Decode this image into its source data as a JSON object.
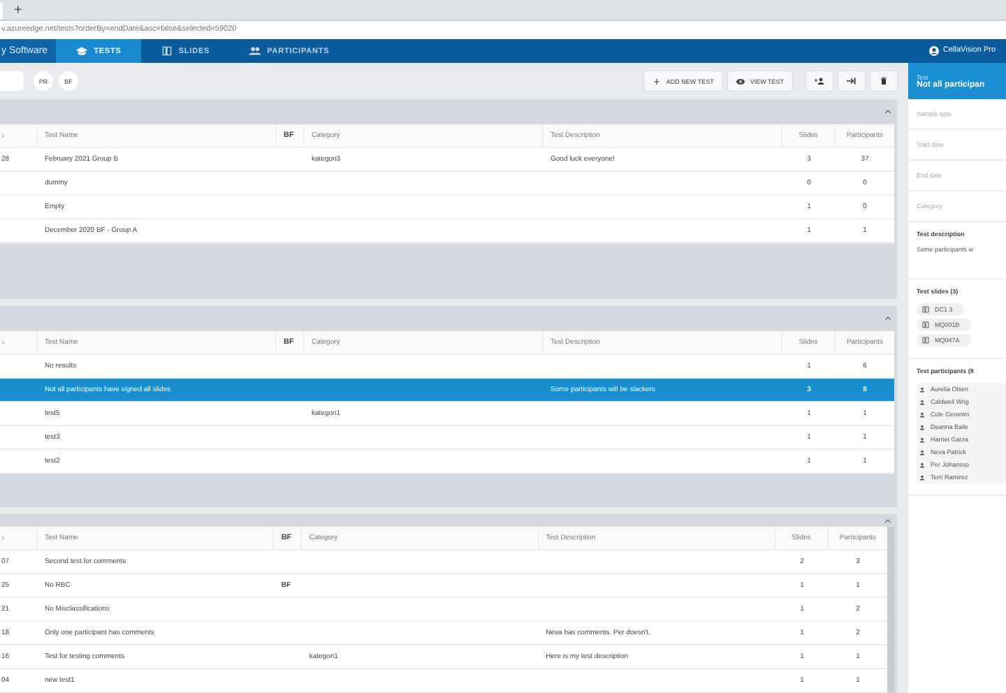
{
  "browser": {
    "new_tab": "+",
    "url": "v.azureedge.net/tests?orderBy=endDate&asc=false&selected=59020"
  },
  "nav": {
    "brand": "y Software",
    "tabs": [
      {
        "label": "TESTS",
        "selected": true
      },
      {
        "label": "SLIDES",
        "selected": false
      },
      {
        "label": "PARTICIPANTS",
        "selected": false
      }
    ],
    "user": "CellaVision Pro"
  },
  "toolbar": {
    "filters": [
      {
        "label": "PR"
      },
      {
        "label": "BF"
      }
    ],
    "buttons": [
      {
        "kind": "add",
        "label": "ADD NEW TEST"
      },
      {
        "kind": "view",
        "label": "VIEW TEST"
      },
      {
        "kind": "add-participant"
      },
      {
        "kind": "export"
      },
      {
        "kind": "delete"
      }
    ]
  },
  "sections": [
    {
      "columns": [
        "↓",
        "Test Name",
        "BF",
        "Category",
        "Test Description",
        "Slides",
        "Participants"
      ],
      "rows": [
        {
          "selected": false,
          "col_1": "28",
          "name": "February 2021 Group B",
          "category": "kategori3",
          "description": "Good luck everyone!",
          "slides": "3",
          "participants": "37"
        },
        {
          "selected": false,
          "name": "dummy",
          "slides": "0",
          "participants": "0"
        },
        {
          "selected": false,
          "name": "Empty",
          "slides": "1",
          "participants": "0"
        },
        {
          "selected": false,
          "name": "December 2020 BF - Group A",
          "slides": "1",
          "participants": "1"
        }
      ]
    },
    {
      "columns": [
        "↓",
        "Test Name",
        "BF",
        "Category",
        "Test Description",
        "Slides",
        "Participants"
      ],
      "rows": [
        {
          "selected": false,
          "name": "No results",
          "slides": "1",
          "participants": "6"
        },
        {
          "selected": true,
          "name": "Not all participants have signed all slides",
          "description": "Some participants will be slackers",
          "slides": "3",
          "participants": "8"
        },
        {
          "selected": false,
          "name": "test5",
          "category": "kategori1",
          "slides": "1",
          "participants": "1"
        },
        {
          "selected": false,
          "name": "test3",
          "slides": "1",
          "participants": "1"
        },
        {
          "selected": false,
          "name": "test2",
          "slides": "1",
          "participants": "1"
        }
      ]
    },
    {
      "columns": [
        "↓",
        "Test Name",
        "BF",
        "Category",
        "Test Description",
        "Slides",
        "Participants"
      ],
      "rows": [
        {
          "selected": false,
          "col_1": "07",
          "name": "Second test for comments",
          "slides": "2",
          "participants": "3"
        },
        {
          "selected": false,
          "col_1": "25",
          "name": "No RBC",
          "bf": "BF",
          "slides": "1",
          "participants": "1"
        },
        {
          "selected": false,
          "col_1": "21",
          "name": "No Misclassifications",
          "slides": "1",
          "participants": "2"
        },
        {
          "selected": false,
          "col_1": "18",
          "name": "Only one participant has comments",
          "description": "Neva has comments. Per doesn't.",
          "slides": "1",
          "participants": "2"
        },
        {
          "selected": false,
          "col_1": "16",
          "name": "Test for testing comments",
          "category": "kategori1",
          "description": "Here is my test description",
          "slides": "1",
          "participants": "1"
        },
        {
          "selected": false,
          "col_1": "04",
          "name": "new test1",
          "slides": "1",
          "participants": "1"
        }
      ]
    }
  ],
  "detail": {
    "header_label": "Test",
    "title": "Not all participan",
    "fields": [
      "Sample type",
      "Start date",
      "End date",
      "Category"
    ],
    "description_label": "Test description",
    "description": "Some participants w",
    "slides_label": "Test slides (3)",
    "slides": [
      "DC1 3",
      "MQ001B",
      "MQ047A"
    ],
    "participants_label": "Test participants (8",
    "participants": [
      "Aurelia Olsen",
      "Caldwell Wrig",
      "Cole Geronim",
      "Deanna Baile",
      "Harriet Garza",
      "Neva Patrick",
      "Per Johansso",
      "Terri Ramirez"
    ]
  }
}
